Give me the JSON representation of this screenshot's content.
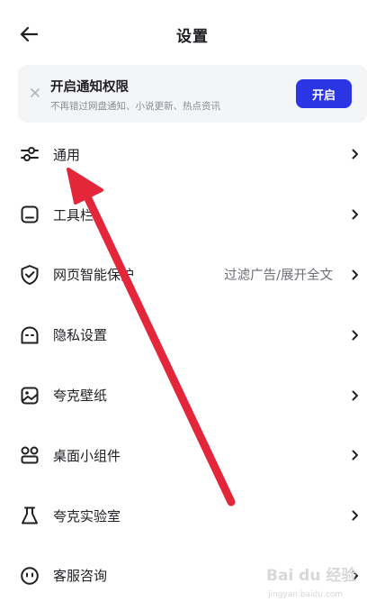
{
  "header": {
    "title": "设置",
    "back_icon": "arrow-left-icon"
  },
  "notice": {
    "title": "开启通知权限",
    "subtitle": "不再错过网盘通知、小说更新、热点资讯",
    "button_label": "开启",
    "close_icon": "close-icon",
    "button_color": "#2a35e6",
    "background": "#f4f5f7"
  },
  "settings": {
    "items": [
      {
        "label": "通用",
        "value": "",
        "icon": "sliders-icon"
      },
      {
        "label": "工具栏",
        "value": "",
        "icon": "toolbar-icon"
      },
      {
        "label": "网页智能保护",
        "value": "过滤广告/展开全文",
        "icon": "shield-check-icon"
      },
      {
        "label": "隐私设置",
        "value": "",
        "icon": "privacy-face-icon"
      },
      {
        "label": "夸克壁纸",
        "value": "",
        "icon": "wallpaper-icon"
      },
      {
        "label": "桌面小组件",
        "value": "",
        "icon": "widget-icon"
      },
      {
        "label": "夸克实验室",
        "value": "",
        "icon": "flask-icon"
      },
      {
        "label": "客服咨询",
        "value": "",
        "icon": "support-face-icon"
      }
    ]
  },
  "annotation": {
    "arrow_color": "#e3263a"
  },
  "watermark": {
    "text": "Bai du 经验",
    "subtext": "jingyan.baidu.com"
  }
}
